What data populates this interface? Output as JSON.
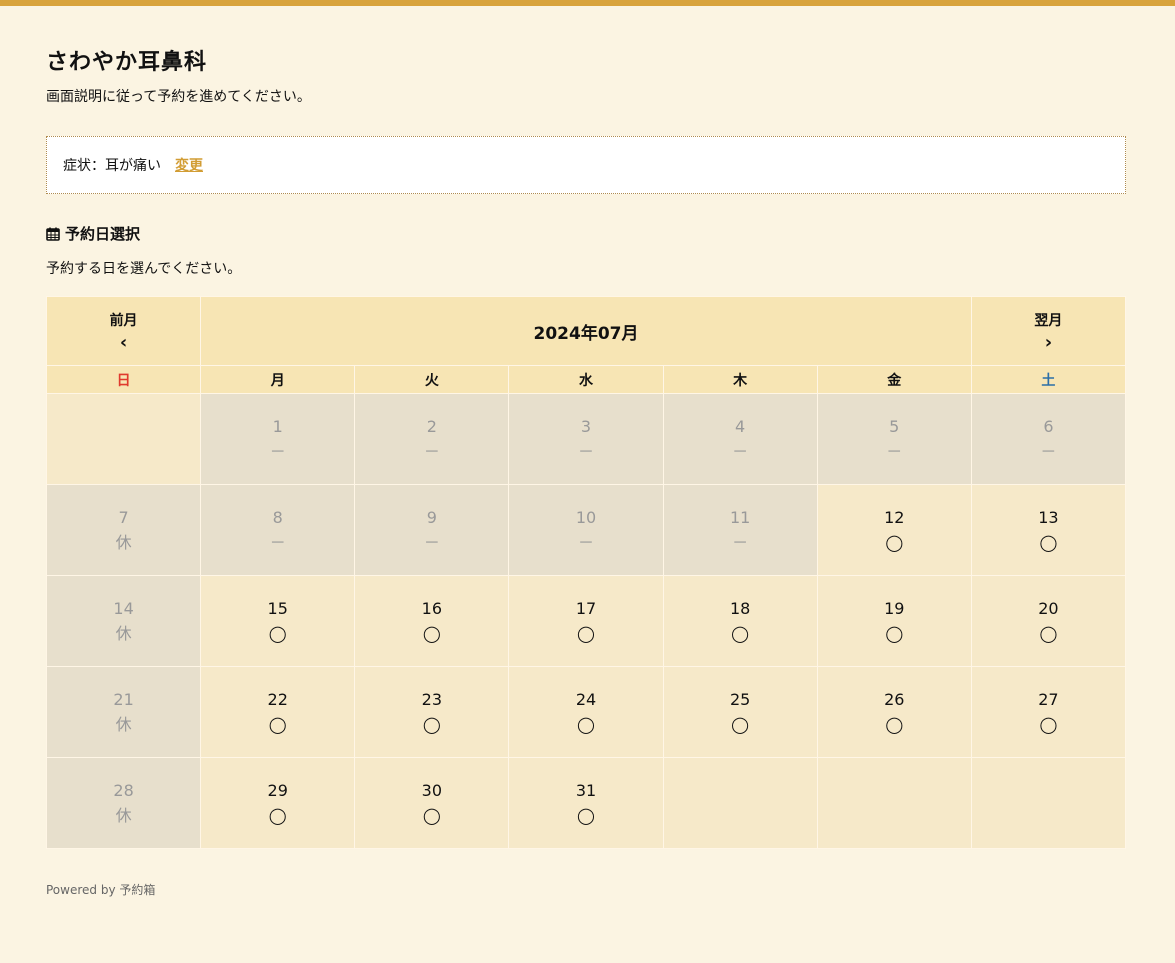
{
  "header": {
    "title": "さわやか耳鼻科",
    "subtitle": "画面説明に従って予約を進めてください。"
  },
  "symptom": {
    "label": "症状：耳が痛い",
    "change_link": "変更"
  },
  "section": {
    "heading": "予約日選択",
    "description": "予約する日を選んでください。"
  },
  "calendar": {
    "prev_label": "前月",
    "next_label": "翌月",
    "month": "2024年07月",
    "weekdays": [
      "日",
      "月",
      "火",
      "水",
      "木",
      "金",
      "土"
    ],
    "weeks": [
      [
        null,
        {
          "d": "1",
          "s": "－"
        },
        {
          "d": "2",
          "s": "－"
        },
        {
          "d": "3",
          "s": "－"
        },
        {
          "d": "4",
          "s": "－"
        },
        {
          "d": "5",
          "s": "－"
        },
        {
          "d": "6",
          "s": "－"
        }
      ],
      [
        {
          "d": "7",
          "s": "休"
        },
        {
          "d": "8",
          "s": "－"
        },
        {
          "d": "9",
          "s": "－"
        },
        {
          "d": "10",
          "s": "－"
        },
        {
          "d": "11",
          "s": "－"
        },
        {
          "d": "12",
          "s": "◯"
        },
        {
          "d": "13",
          "s": "◯"
        }
      ],
      [
        {
          "d": "14",
          "s": "休"
        },
        {
          "d": "15",
          "s": "◯"
        },
        {
          "d": "16",
          "s": "◯"
        },
        {
          "d": "17",
          "s": "◯"
        },
        {
          "d": "18",
          "s": "◯"
        },
        {
          "d": "19",
          "s": "◯"
        },
        {
          "d": "20",
          "s": "◯"
        }
      ],
      [
        {
          "d": "21",
          "s": "休"
        },
        {
          "d": "22",
          "s": "◯"
        },
        {
          "d": "23",
          "s": "◯"
        },
        {
          "d": "24",
          "s": "◯"
        },
        {
          "d": "25",
          "s": "◯"
        },
        {
          "d": "26",
          "s": "◯"
        },
        {
          "d": "27",
          "s": "◯"
        }
      ],
      [
        {
          "d": "28",
          "s": "休"
        },
        {
          "d": "29",
          "s": "◯"
        },
        {
          "d": "30",
          "s": "◯"
        },
        {
          "d": "31",
          "s": "◯"
        },
        null,
        null,
        null
      ]
    ]
  },
  "footer": {
    "text": "Powered by 予約箱"
  },
  "colors": {
    "accent": "#d8a33c",
    "sunday": "#e03a2e",
    "saturday": "#2d6fa8"
  }
}
